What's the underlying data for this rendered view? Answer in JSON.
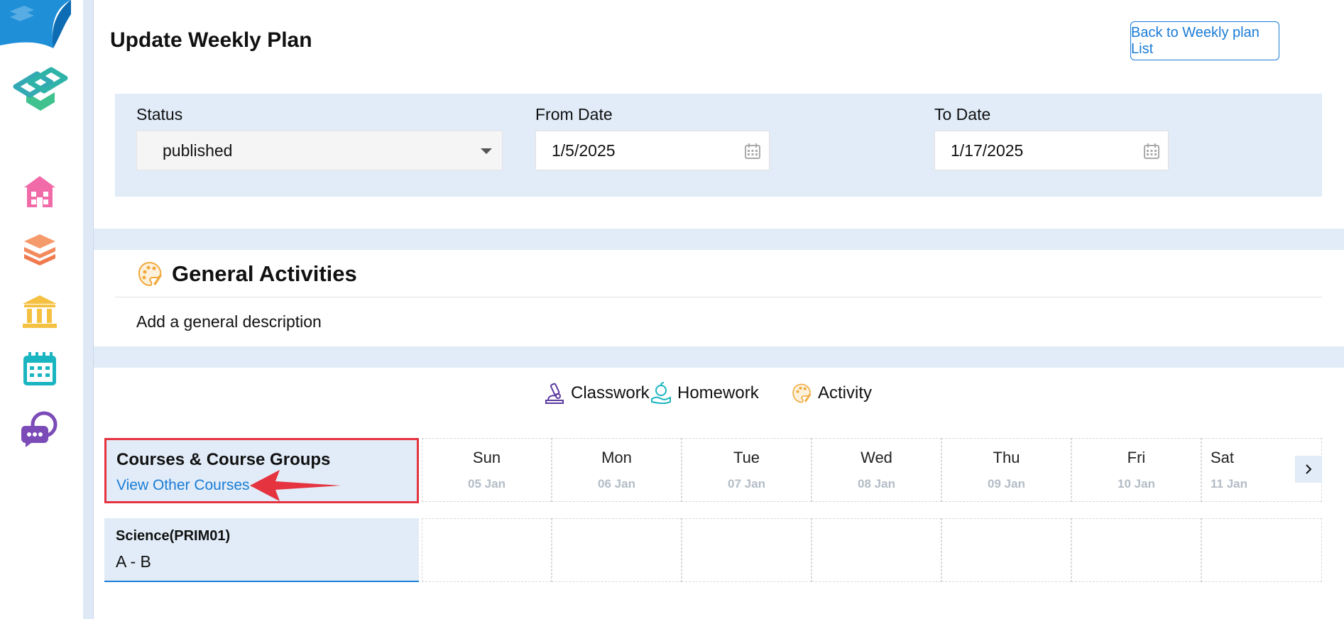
{
  "header": {
    "title": "Update Weekly Plan",
    "back_label": "Back to Weekly plan List"
  },
  "filters": {
    "status_label": "Status",
    "status_value": "published",
    "from_label": "From Date",
    "from_value": "1/5/2025",
    "to_label": "To Date",
    "to_value": "1/17/2025"
  },
  "general": {
    "title": "General Activities",
    "description_placeholder": "Add a general description"
  },
  "legend": {
    "classwork": "Classwork",
    "homework": "Homework",
    "activity": "Activity"
  },
  "courses": {
    "title": "Courses & Course Groups",
    "link": "View Other Courses"
  },
  "days": [
    {
      "name": "Sun",
      "date": "05 Jan"
    },
    {
      "name": "Mon",
      "date": "06 Jan"
    },
    {
      "name": "Tue",
      "date": "07 Jan"
    },
    {
      "name": "Wed",
      "date": "08 Jan"
    },
    {
      "name": "Thu",
      "date": "09 Jan"
    },
    {
      "name": "Fri",
      "date": "10 Jan"
    },
    {
      "name": "Sat",
      "date": "11 Jan"
    }
  ],
  "course_rows": [
    {
      "name": "Science(PRIM01)",
      "group": "A - B"
    }
  ],
  "sidebar": {
    "icons": [
      "school-icon",
      "books-icon",
      "institution-icon",
      "calendar-icon",
      "chat-icon"
    ]
  },
  "colors": {
    "accent": "#1a7cd6",
    "panel": "#e1ecf8",
    "highlight": "#e53340"
  }
}
